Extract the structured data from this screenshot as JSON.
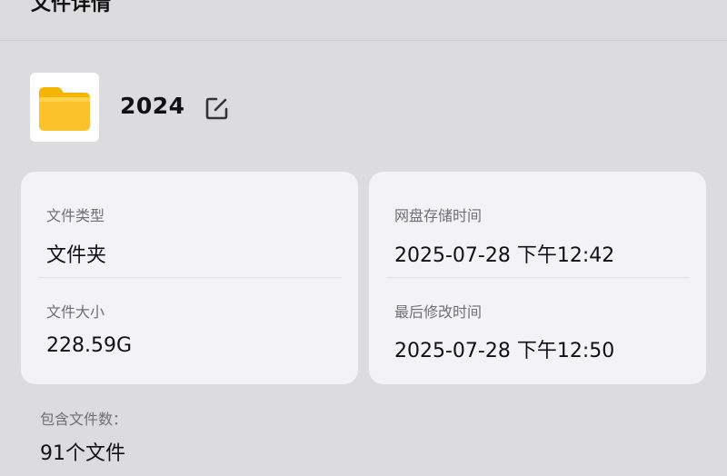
{
  "header": {
    "title": "文件详情",
    "close_icon": "close-icon"
  },
  "folder": {
    "name": "2024",
    "icon": "folder-icon",
    "rename_icon": "edit-icon"
  },
  "info": {
    "type_label": "文件类型",
    "type_value": "文件夹",
    "size_label": "文件大小",
    "size_value": "228.59G",
    "stored_label": "网盘存储时间",
    "stored_value": "2025-07-28 下午12:42",
    "modified_label": "最后修改时间",
    "modified_value": "2025-07-28 下午12:50"
  },
  "contents": {
    "count_label": "包含文件数：",
    "count_value": "91个文件"
  },
  "colors": {
    "background": "#dcdcde",
    "card": "#f3f3f5",
    "folder_yellow": "#fcc22a",
    "label_gray": "#6e6e73"
  }
}
